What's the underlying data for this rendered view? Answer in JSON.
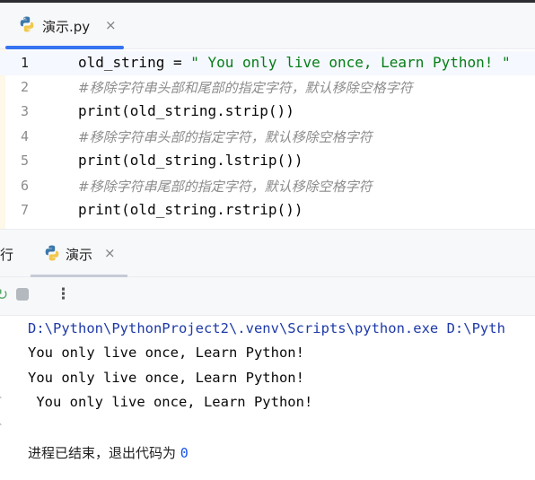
{
  "editor_tab": {
    "label": "演示.py",
    "close": "×"
  },
  "code_lines": [
    {
      "number": "1",
      "parts": [
        [
          "plain",
          "old_string = "
        ],
        [
          "str",
          "\" You only live once, Learn Python! \""
        ]
      ]
    },
    {
      "number": "2",
      "comment": "#移除字符串头部和尾部的指定字符，默认移除空格字符"
    },
    {
      "number": "3",
      "parts": [
        [
          "plain",
          "print(old_string.strip())"
        ]
      ]
    },
    {
      "number": "4",
      "comment": "#移除字符串头部的指定字符，默认移除空格字符"
    },
    {
      "number": "5",
      "parts": [
        [
          "plain",
          "print(old_string.lstrip())"
        ]
      ]
    },
    {
      "number": "6",
      "comment": "#移除字符串尾部的指定字符，默认移除空格字符"
    },
    {
      "number": "7",
      "parts": [
        [
          "plain",
          "print(old_string.rstrip())"
        ]
      ]
    }
  ],
  "run_panel": {
    "title": "行",
    "tab_label": "演示",
    "close": "×",
    "more": "⋮"
  },
  "console": {
    "command": "D:\\Python\\PythonProject2\\.venv\\Scripts\\python.exe D:\\Pyth",
    "outputs": [
      "You only live once, Learn Python!",
      "You only live once, Learn Python!",
      " You only live once, Learn Python!"
    ],
    "exit_text": "进程已结束，退出代码为 ",
    "exit_code": "0"
  }
}
